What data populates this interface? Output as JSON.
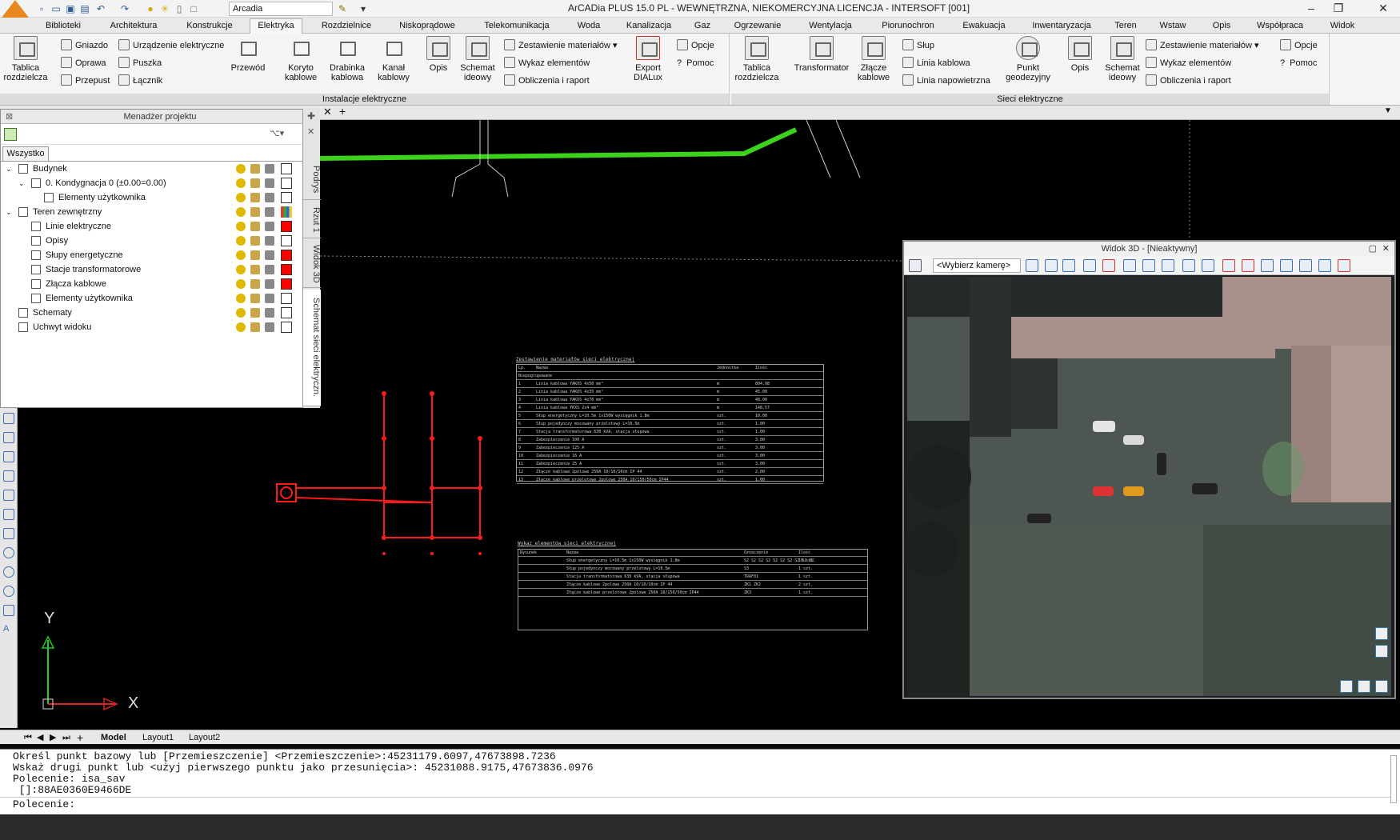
{
  "app": {
    "title": "ArCADia PLUS 15.0 PL - WEWNĘTRZNA, NIEKOMERCYJNA LICENCJA - INTERSOFT [001]",
    "workspace": "Arcadia"
  },
  "menu_tabs": [
    "Biblioteki",
    "Architektura",
    "Konstrukcje",
    "Elektryka",
    "Rozdzielnice",
    "Niskoprądowe",
    "Telekomunikacja",
    "Woda",
    "Kanalizacja",
    "Gaz",
    "Ogrzewanie",
    "Wentylacja",
    "Piorunochron",
    "Ewakuacja",
    "Inwentaryzacja",
    "Teren",
    "Wstaw",
    "Opis",
    "Współpraca",
    "Widok"
  ],
  "active_tab": "Elektryka",
  "ribbon": {
    "group1_title": "Instalacje elektryczne",
    "group2_title": "Sieci elektryczne",
    "tablica": "Tablica\nrozdzielcza",
    "gniazdo": "Gniazdo",
    "urzadzenie": "Urządzenie elektryczne",
    "oprawa": "Oprawa",
    "puszka": "Puszka",
    "przepust": "Przepust",
    "lacznik": "Łącznik",
    "przewod": "Przewód",
    "koryto": "Koryto\nkablowe",
    "drabinka": "Drabinka\nkablowa",
    "kanal": "Kanał\nkablowy",
    "opis": "Opis",
    "schemat": "Schemat\nideowy",
    "zestawienie": "Zestawienie materiałów",
    "wykaz": "Wykaz elementów",
    "obliczenia": "Obliczenia i raport",
    "export": "Export\nDIALux",
    "opcje": "Opcje",
    "pomoc": "Pomoc",
    "tablica2": "Tablica\nrozdzielcza",
    "transformator": "Transformator",
    "zlacze": "Złącze\nkablowe",
    "slup": "Słup",
    "linia_kablowa": "Linia kablowa",
    "linia_nap": "Linia napowietrzna",
    "punkt": "Punkt\ngeodezyjny",
    "opis2": "Opis",
    "schemat2": "Schemat\nideowy",
    "zestawienie2": "Zestawienie materiałów",
    "wykaz2": "Wykaz elementów",
    "obliczenia2": "Obliczenia i raport",
    "opcje2": "Opcje",
    "pomoc2": "Pomoc"
  },
  "project_manager": {
    "title": "Menadżer projektu",
    "filter_tab": "Wszystko",
    "tree": [
      {
        "label": "Budynek",
        "level": 1,
        "expanded": true,
        "color": "none"
      },
      {
        "label": "0. Kondygnacja 0 (±0.00=0.00)",
        "level": 2,
        "expanded": true,
        "color": "none"
      },
      {
        "label": "Elementy użytkownika",
        "level": 3,
        "color": "none"
      },
      {
        "label": "Teren zewnętrzny",
        "level": 1,
        "expanded": true,
        "color": "multi"
      },
      {
        "label": "Linie elektryczne",
        "level": 2,
        "color": "#ff0000"
      },
      {
        "label": "Opisy",
        "level": 2,
        "color": "none"
      },
      {
        "label": "Słupy energetyczne",
        "level": 2,
        "color": "#ff0000"
      },
      {
        "label": "Stacje transformatorowe",
        "level": 2,
        "color": "#ff0000"
      },
      {
        "label": "Złącza kablowe",
        "level": 2,
        "color": "#ff0000"
      },
      {
        "label": "Elementy użytkownika",
        "level": 2,
        "color": "none"
      },
      {
        "label": "Schematy",
        "level": 1,
        "color": "none"
      },
      {
        "label": "Uchwyt widoku",
        "level": 1,
        "color": "none"
      }
    ],
    "side_tabs": [
      "Podrys",
      "Rzut 1",
      "Widok 3D",
      "Schemat sieci elektryczn."
    ]
  },
  "view3d": {
    "title": "Widok 3D - [Nieaktywny]",
    "camera_placeholder": "<Wybierz kamerę>"
  },
  "drawing": {
    "table1_title": "Zestawienie materiałów sieci elektrycznej",
    "table1_header": [
      "Lp.",
      "Nazwa",
      "Jednostka",
      "Ilość"
    ],
    "table1_group": "Niepogrupowane",
    "table1_rows": [
      [
        "1",
        "Linia kablowa YAKXS 4x50 mm²",
        "m",
        "804.98"
      ],
      [
        "2",
        "Linia kablowa YAKXS 4x35 mm²",
        "m",
        "45.00"
      ],
      [
        "3",
        "Linia kablowa YAKXS 4x70 mm²",
        "m",
        "48.00"
      ],
      [
        "4",
        "Linia kablowa YKXS 2x4 mm²",
        "m",
        "148.57"
      ],
      [
        "5",
        "Słup energetyczny L=10.5m 1x150W wysięgnik 1.8m",
        "szt.",
        "10.00"
      ],
      [
        "6",
        "Słup pojedynczy mocowany przelotowy L=10.5m",
        "szt.",
        "1.00"
      ],
      [
        "7",
        "Stacja transformatorowa 630 kVA, stacja słupowa",
        "szt.",
        "1.00"
      ],
      [
        "8",
        "Zabezpieczenie 100 A",
        "szt.",
        "3.00"
      ],
      [
        "9",
        "Zabezpieczenie 125 A",
        "szt.",
        "3.00"
      ],
      [
        "10",
        "Zabezpieczenie 16 A",
        "szt.",
        "3.00"
      ],
      [
        "11",
        "Zabezpieczenie 25 A",
        "szt.",
        "3.00"
      ],
      [
        "12",
        "Złącze kablowe 2polowe 250A 10/10/10cm IP 44",
        "szt.",
        "2.00"
      ],
      [
        "13",
        "Złącze kablowe przelotowe 2polowe 250A 10/150/50cm IP44",
        "szt.",
        "1.00"
      ]
    ],
    "table2_title": "Wykaz elementów sieci elektrycznej",
    "table2_header": [
      "Rysunek",
      "Nazwa",
      "Oznaczenie",
      "Ilość"
    ],
    "table2_rows": [
      [
        "",
        "Słup energetyczny L=10.5m 1x150W wysięgnik 1.8m",
        "S2 S2 S2 S2 S2 S2 S2 S2 S2 S2",
        "10 szt."
      ],
      [
        "",
        "Słup pojedynczy mocowany przelotowy L=10.5m",
        "S3",
        "1 szt."
      ],
      [
        "",
        "Stacja transformatorowa 630 kVA, stacja słupowa",
        "TRAF01",
        "1 szt."
      ],
      [
        "",
        "Złącze kablowe 2polowe 250A 10/10/10cm IP 44",
        "ZK1 ZK2",
        "2 szt."
      ],
      [
        "",
        "Złącze kablowe przelotowe 2polowe 250A 10/150/50cm IP44",
        "ZK3",
        "1 szt."
      ]
    ]
  },
  "ucs": {
    "x": "X",
    "y": "Y"
  },
  "layout_tabs": [
    "Model",
    "Layout1",
    "Layout2"
  ],
  "command_history": [
    "Określ punkt bazowy lub [Przemieszczenie] <Przemieszczenie>:45231179.6097,47673898.7236",
    "Wskaż drugi punkt lub <użyj pierwszego punktu jako przesunięcia>: 45231088.9175,47673836.0976",
    "Polecenie: isa_sav",
    " []:88AE0360E9466DE"
  ],
  "command_prompt": "Polecenie:",
  "colors": {
    "accent": "#2f6db5",
    "cable_green": "#3cd21c",
    "schema_red": "#ff1a1a"
  }
}
